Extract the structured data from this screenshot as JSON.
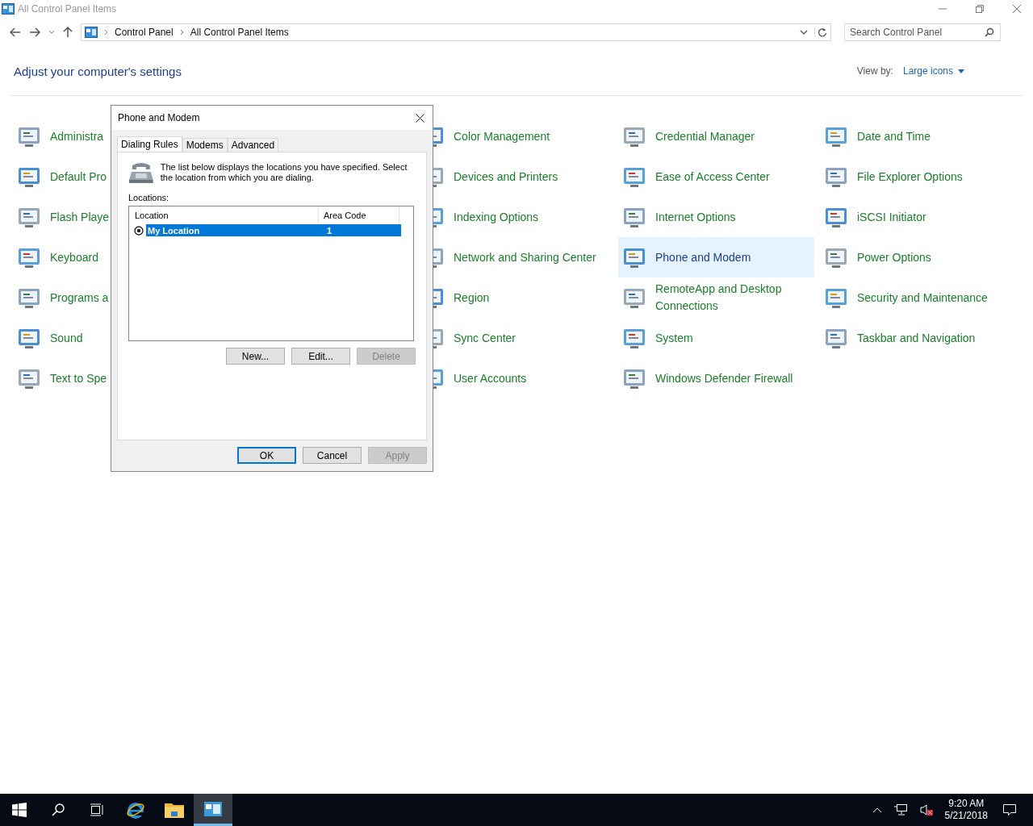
{
  "window": {
    "title": "All Control Panel Items"
  },
  "address_bar": {
    "path": [
      "Control Panel",
      "All Control Panel Items"
    ]
  },
  "search": {
    "placeholder": "Search Control Panel"
  },
  "heading": "Adjust your computer's settings",
  "view_by": {
    "label": "View by:",
    "value": "Large icons"
  },
  "columns": [
    [
      {
        "label": "Administra",
        "selected": false
      },
      {
        "label": "Default Pro",
        "selected": false
      },
      {
        "label": "Flash Playe",
        "selected": false
      },
      {
        "label": "Keyboard",
        "selected": false
      },
      {
        "label": "Programs a",
        "selected": false
      },
      {
        "label": "Sound",
        "selected": false
      },
      {
        "label": "Text to Spe",
        "selected": false
      }
    ],
    [
      {
        "label": "Color Management",
        "selected": false
      },
      {
        "label": "Devices and Printers",
        "selected": false
      },
      {
        "label": "Indexing Options",
        "selected": false
      },
      {
        "label": "Network and Sharing Center",
        "selected": false
      },
      {
        "label": "Region",
        "selected": false
      },
      {
        "label": "Sync Center",
        "selected": false
      },
      {
        "label": "User Accounts",
        "selected": false
      }
    ],
    [
      {
        "label": "Credential Manager",
        "selected": false
      },
      {
        "label": "Ease of Access Center",
        "selected": false
      },
      {
        "label": "Internet Options",
        "selected": false
      },
      {
        "label": "Phone and Modem",
        "selected": true
      },
      {
        "label": "RemoteApp and Desktop Connections",
        "selected": false
      },
      {
        "label": "System",
        "selected": false
      },
      {
        "label": "Windows Defender Firewall",
        "selected": false
      }
    ],
    [
      {
        "label": "Date and Time",
        "selected": false
      },
      {
        "label": "File Explorer Options",
        "selected": false
      },
      {
        "label": "iSCSI Initiator",
        "selected": false
      },
      {
        "label": "Power Options",
        "selected": false
      },
      {
        "label": "Security and Maintenance",
        "selected": false
      },
      {
        "label": "Taskbar and Navigation",
        "selected": false
      }
    ]
  ],
  "dialog": {
    "title": "Phone and Modem",
    "tabs": [
      {
        "label": "Dialing Rules",
        "selected": true
      },
      {
        "label": "Modems",
        "selected": false
      },
      {
        "label": "Advanced",
        "selected": false
      }
    ],
    "description": "The list below displays the locations you have specified. Select the location from which you are dialing.",
    "list_label": "Locations:",
    "table": {
      "columns": [
        "Location",
        "Area Code"
      ],
      "rows": [
        {
          "location": "My Location",
          "area_code": "1",
          "selected": true
        }
      ]
    },
    "list_buttons": [
      {
        "label": "New...",
        "disabled": false
      },
      {
        "label": "Edit...",
        "disabled": false
      },
      {
        "label": "Delete",
        "disabled": true
      }
    ],
    "buttons": [
      {
        "label": "OK",
        "disabled": false
      },
      {
        "label": "Cancel",
        "disabled": false
      },
      {
        "label": "Apply",
        "disabled": true
      }
    ]
  },
  "taskbar": {
    "apps": [
      {
        "kind": "start",
        "selected": false
      },
      {
        "kind": "search",
        "selected": false
      },
      {
        "kind": "taskview",
        "selected": false
      },
      {
        "kind": "browser",
        "selected": false
      },
      {
        "kind": "explorer",
        "selected": false
      },
      {
        "kind": "controlpanel",
        "selected": true
      }
    ],
    "time": "9:20 AM",
    "date": "5/21/2018"
  }
}
